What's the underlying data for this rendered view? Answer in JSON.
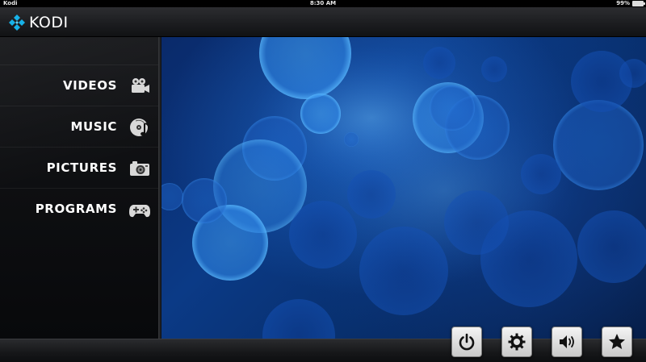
{
  "status_bar": {
    "carrier": "Kodi",
    "time": "8:30 AM",
    "battery": "99%"
  },
  "header": {
    "brand": "KODI",
    "logo_icon": "kodi-logo-icon"
  },
  "menu": {
    "items": [
      {
        "label": "VIDEOS",
        "icon": "film-camera-icon"
      },
      {
        "label": "MUSIC",
        "icon": "music-disc-icon"
      },
      {
        "label": "PICTURES",
        "icon": "photo-camera-icon"
      },
      {
        "label": "PROGRAMS",
        "icon": "gamepad-icon"
      }
    ]
  },
  "controls": [
    {
      "icon": "power-icon"
    },
    {
      "icon": "settings-gear-icon"
    },
    {
      "icon": "volume-icon"
    },
    {
      "icon": "favourites-star-icon"
    }
  ],
  "colors": {
    "accent_blue": "#1e6fd0",
    "logo_blue": "#17b2e8",
    "background_dark": "#0b3a86",
    "text": "#ffffff"
  }
}
